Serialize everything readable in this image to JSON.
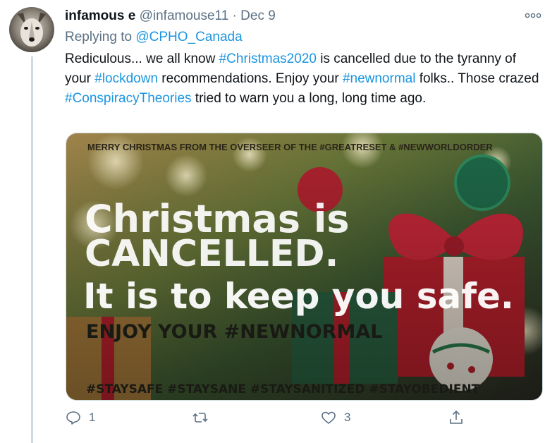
{
  "tweet": {
    "display_name": "infamous e",
    "handle": "@infamouse11",
    "separator": "·",
    "date": "Dec 9",
    "more_icon": "more-horizontal-icon",
    "replying_prefix": "Replying to",
    "replying_to": "@CPHO_Canada",
    "body": {
      "t1": "Rediculous... we all know ",
      "h1": "#Christmas2020",
      "t2": " is cancelled due to the tyranny of your ",
      "h2": "#lockdown",
      "t3": " recommendations.  Enjoy your ",
      "h3": "#newnormal",
      "t4": " folks.. Those crazed ",
      "h4": "#ConspiracyTheories",
      "t5": " tried to warn you a long, long time ago."
    },
    "hashtag_color": "#1b95e0"
  },
  "media": {
    "top_line": "MERRY CHRISTMAS FROM THE OVERSEER OF THE #GREATRESET & #NEWWORLDORDER",
    "line1": "Christmas is",
    "line2": "CANCELLED.",
    "line3": "It is to keep you safe.",
    "line4": "ENJOY YOUR #NEWNORMAL",
    "bottom_line": "#STAYSAFE #STAYSANE #STAYSANITIZED #STAYOBEDIENT"
  },
  "actions": {
    "reply_count": "1",
    "retweet_count": "",
    "like_count": "3",
    "icons": [
      "reply-icon",
      "retweet-icon",
      "like-icon",
      "share-icon"
    ]
  }
}
